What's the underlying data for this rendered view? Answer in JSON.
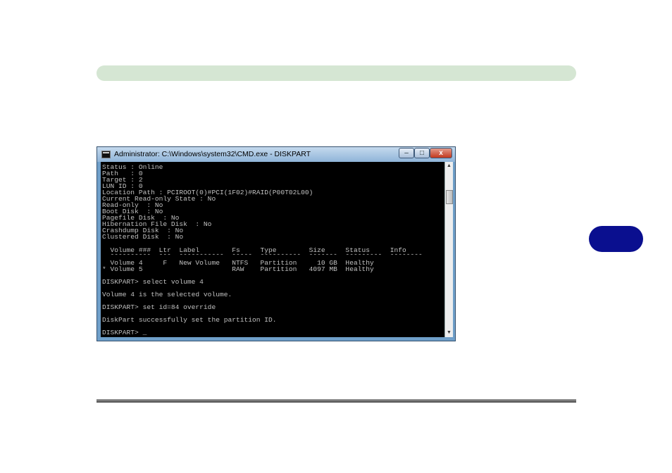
{
  "window": {
    "title": "Administrator: C:\\Windows\\system32\\CMD.exe - DISKPART",
    "minimize_glyph": "–",
    "maximize_glyph": "□",
    "close_glyph": "x"
  },
  "console": {
    "lines": [
      "Status : Online",
      "Path   : 0",
      "Target : 2",
      "LUN ID : 0",
      "Location Path : PCIROOT(0)#PCI(1F02)#RAID(P00T02L00)",
      "Current Read-only State : No",
      "Read-only  : No",
      "Boot Disk  : No",
      "Pagefile Disk  : No",
      "Hibernation File Disk  : No",
      "Crashdump Disk  : No",
      "Clustered Disk  : No",
      "",
      "  Volume ###  Ltr  Label        Fs     Type        Size     Status     Info",
      "  ----------  ---  -----------  -----  ----------  -------  ---------  --------",
      "  Volume 4     F   New Volume   NTFS   Partition     10 GB  Healthy",
      "* Volume 5                      RAW    Partition   4097 MB  Healthy",
      "",
      "DISKPART> select volume 4",
      "",
      "Volume 4 is the selected volume.",
      "",
      "DISKPART> set id=84 override",
      "",
      "DiskPart successfully set the partition ID.",
      "",
      "DISKPART> _"
    ]
  },
  "colors": {
    "header_bar": "#d5e6d3",
    "chapter_tab": "#0a0f8f",
    "console_text": "#c0c0c0",
    "console_bg": "#000000"
  }
}
